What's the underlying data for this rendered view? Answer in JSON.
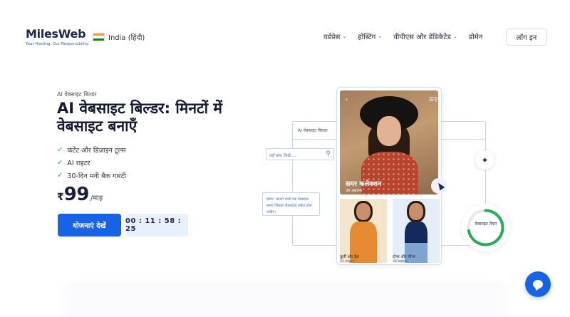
{
  "header": {
    "logo_text": "MilesWeb",
    "logo_tagline": "Your Hosting, Our Responsibility.",
    "language": "India (हिंदी)",
    "flag_colors": [
      "#ff9933",
      "#ffffff",
      "#138808"
    ],
    "nav": [
      {
        "label": "वर्डप्रेस",
        "has_dropdown": true
      },
      {
        "label": "होस्टिंग",
        "has_dropdown": true
      },
      {
        "label": "वीपीएस और डेडिकेटेड",
        "has_dropdown": true
      },
      {
        "label": "डोमेन",
        "has_dropdown": false
      }
    ],
    "login_label": "लॉग इन"
  },
  "hero": {
    "eyebrow": "AI वेबसाइट बिल्डर",
    "title": "AI वेबसाइट बिल्डर: मिनटों में वेबसाइट बनाएँ",
    "features": [
      "कंटेंट और डिज़ाइन टूल्स",
      "AI राइटर",
      "30-दिन मनी बैक गारंटी"
    ],
    "price_currency": "₹",
    "price_value": "99",
    "price_period": "/माह",
    "cta_label": "योजनाएं देखें",
    "timer": "00 : 11 : 58 : 25"
  },
  "illustration": {
    "frame_label": "AI वेबसाइट बिल्डर",
    "search_placeholder": "यहाँ प्रांप्ट लिखें......",
    "prompt_text": "प्रॉम्प्ट- कपड़ों वाली एक वेबसाइट बनाएं जिसका बैकग्राउंड सफ़ेद होना चाहिए।",
    "hero_caption": "समर कलेक्शन",
    "hero_sub": "38 आइटम्स",
    "products": [
      {
        "name": "कुर्ती और ड्रेस",
        "count": "21 आइटम्स"
      },
      {
        "name": "टॉप्स और जीन्स",
        "count": "38 आइटम्स"
      }
    ],
    "progress_label": "वेबसाइट तैयार",
    "progress_fraction": 0.72,
    "accent_color": "#2bab5a"
  },
  "colors": {
    "primary": "#1763e6",
    "timer_bg": "#e8f0fd",
    "check": "#2bab5a"
  }
}
